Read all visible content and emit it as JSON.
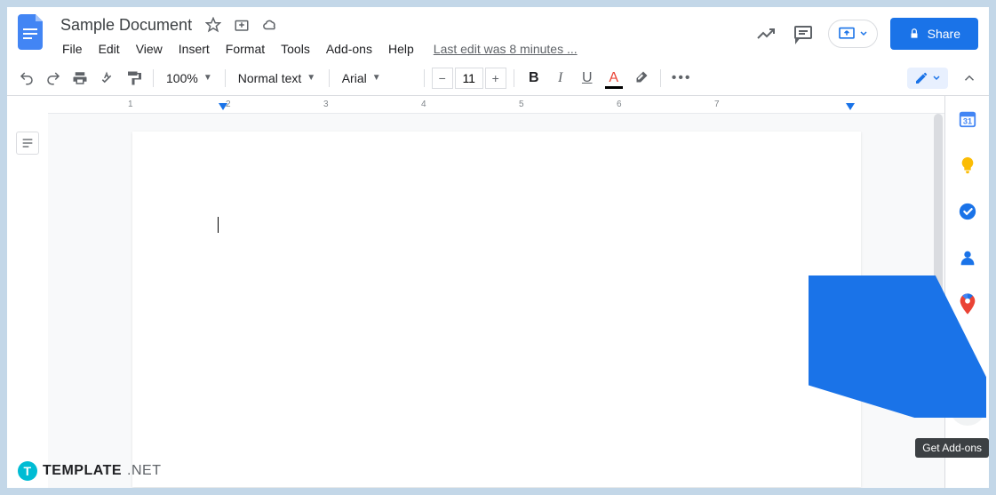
{
  "header": {
    "title": "Sample Document",
    "last_edit": "Last edit was 8 minutes ...",
    "share_label": "Share"
  },
  "menubar": {
    "items": [
      "File",
      "Edit",
      "View",
      "Insert",
      "Format",
      "Tools",
      "Add-ons",
      "Help"
    ]
  },
  "toolbar": {
    "zoom": "100%",
    "style": "Normal text",
    "font": "Arial",
    "font_size": "11"
  },
  "side_panel": {
    "tooltip": "Get Add-ons"
  },
  "watermark": {
    "brand": "TEMPLATE",
    "suffix": ".NET"
  },
  "ruler": {
    "marks": [
      "1",
      "2",
      "3",
      "4",
      "5",
      "6",
      "7"
    ]
  }
}
